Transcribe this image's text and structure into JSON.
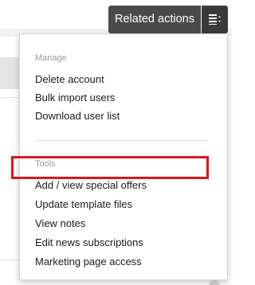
{
  "toolbar": {
    "related_actions_label": "Related actions",
    "menu_icon": "menu-list-icon"
  },
  "dropdown": {
    "manage": {
      "heading": "Manage",
      "items": [
        "Delete account",
        "Bulk import users",
        "Download user list"
      ]
    },
    "tools": {
      "heading": "Tools",
      "items": [
        "Add / view special offers",
        "Update template files",
        "View notes",
        "Edit news subscriptions",
        "Marketing page access"
      ]
    }
  },
  "highlight": {
    "item": "Update template files",
    "color": "#e0141c"
  }
}
